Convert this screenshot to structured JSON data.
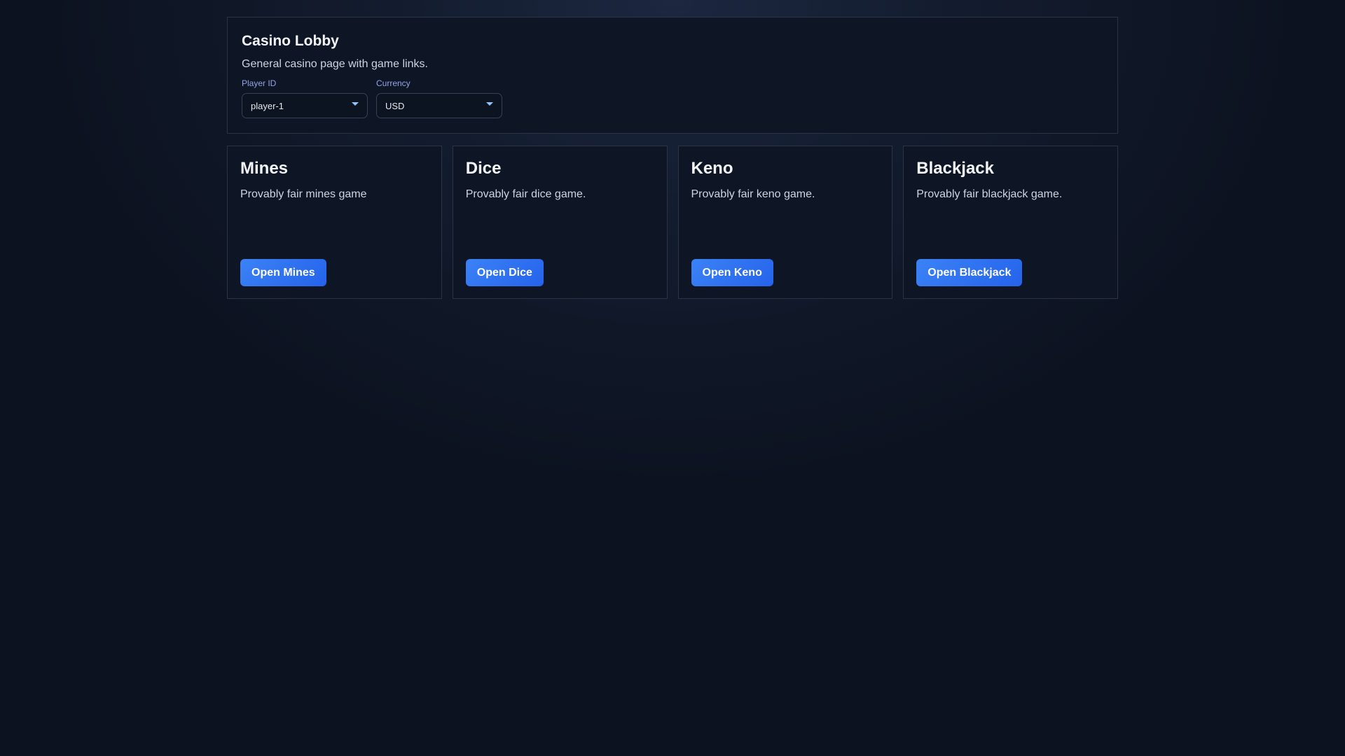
{
  "header": {
    "title": "Casino Lobby",
    "subtitle": "General casino page with game links.",
    "player_label": "Player ID",
    "player_value": "player-1",
    "currency_label": "Currency",
    "currency_value": "USD"
  },
  "games": [
    {
      "title": "Mines",
      "desc": "Provably fair mines game",
      "button": "Open Mines"
    },
    {
      "title": "Dice",
      "desc": "Provably fair dice game.",
      "button": "Open Dice"
    },
    {
      "title": "Keno",
      "desc": "Provably fair keno game.",
      "button": "Open Keno"
    },
    {
      "title": "Blackjack",
      "desc": "Provably fair blackjack game.",
      "button": "Open Blackjack"
    }
  ]
}
